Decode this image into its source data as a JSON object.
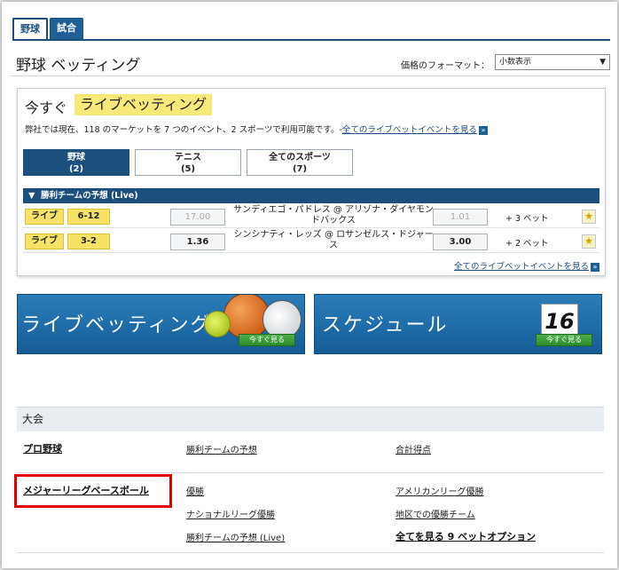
{
  "top_tabs": [
    {
      "label": "野球",
      "active": true
    },
    {
      "label": "試合",
      "active": false
    }
  ],
  "header": {
    "title": "野球 ベッティング",
    "format_label": "価格のフォーマット：",
    "format_value": "小数表示"
  },
  "live": {
    "heading_prefix": "今すぐ",
    "heading_highlight": "ライブベッティング",
    "info_text": "弊社では現在、118 のマーケットを 7 つのイベント、2 スポーツで利用可能です。-",
    "info_link": "全てのライブベットイベントを見る",
    "sport_tabs": [
      {
        "label": "野球",
        "count": "(2)",
        "active": true
      },
      {
        "label": "テニス",
        "count": "(5)",
        "active": false
      },
      {
        "label": "全てのスポーツ",
        "count": "(7)",
        "active": false
      }
    ],
    "market_title": "勝利チームの予想 (Live)",
    "events": [
      {
        "status": "ライブ",
        "score": "6-12",
        "home_odds": "17.00",
        "home_dim": true,
        "teams_line1": "サンディエゴ・パドレス @ アリゾナ・ダイヤモン",
        "teams_line2": "ドバックス",
        "away_odds": "1.01",
        "away_dim": true,
        "more_bets": "+ 3 ベット"
      },
      {
        "status": "ライブ",
        "score": "3-2",
        "home_odds": "1.36",
        "home_dim": false,
        "teams_line1": "シンシナティ・レッズ @ ロサンゼルス・ドジャー",
        "teams_line2": "ス",
        "away_odds": "3.00",
        "away_dim": false,
        "more_bets": "+ 2 ベット"
      }
    ],
    "bottom_link": "全てのライブベットイベントを見る"
  },
  "banners": {
    "live_title": "ライブベッティング",
    "live_button": "今すぐ見る",
    "schedule_title": "スケジュール",
    "schedule_button": "今すぐ見る",
    "calendar_number": "16"
  },
  "tournaments": {
    "header": "大会",
    "rows": [
      {
        "name": "プロ野球",
        "links": [
          "勝利チームの予想",
          "合計得点"
        ]
      },
      {
        "name": "メジャーリーグベースボール",
        "links": [
          "優勝",
          "アメリカンリーグ優勝",
          "ナショナルリーグ優勝",
          "地区での優勝チーム",
          "勝利チームの予想 (Live)"
        ],
        "see_all": "全てを見る 9 ベットオプション"
      }
    ]
  },
  "colors": {
    "brand_blue": "#1c4f7c",
    "live_yellow": "#f6e266",
    "highlight_red": "#e00000"
  }
}
